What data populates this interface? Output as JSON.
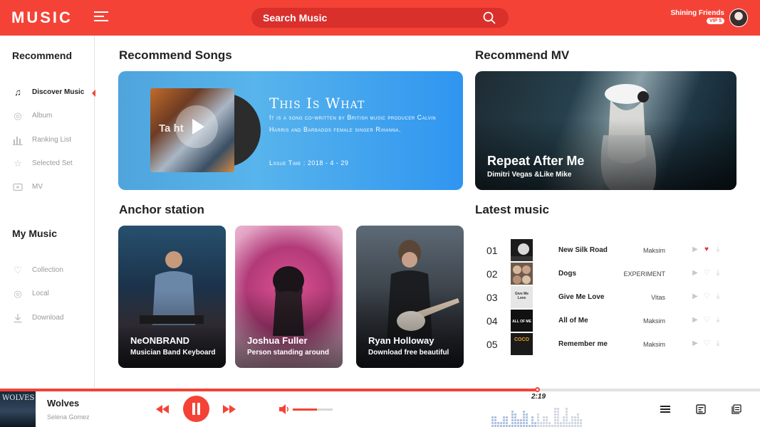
{
  "header": {
    "logo": "MUSIC",
    "search_placeholder": "Search Music",
    "user_name": "Shining Friends",
    "vip_badge": "VIP 5"
  },
  "sidebar": {
    "section1_title": "Recommend",
    "items1": [
      {
        "label": "Discover Music",
        "icon": "music-note-icon",
        "active": true
      },
      {
        "label": "Album",
        "icon": "album-icon"
      },
      {
        "label": "Ranking List",
        "icon": "bar-chart-icon"
      },
      {
        "label": "Selected Set",
        "icon": "star-icon"
      },
      {
        "label": "MV",
        "icon": "video-icon"
      }
    ],
    "section2_title": "My Music",
    "items2": [
      {
        "label": "Collection",
        "icon": "heart-icon"
      },
      {
        "label": "Local",
        "icon": "disc-icon"
      },
      {
        "label": "Download",
        "icon": "download-icon"
      }
    ]
  },
  "recommend_songs": {
    "title": "Recommend Songs",
    "cover_text": "Ta       ht",
    "song_title": "This Is What",
    "description": "It is a song co-written by British music producer Calvin Harris and Barbados female singer Rihanna.",
    "issue": "Lssue Time : 2018 - 4 - 29"
  },
  "recommend_mv": {
    "title": "Recommend MV",
    "mv_title": "Repeat After Me",
    "mv_artist": "Dimitri Vegas &Like Mike"
  },
  "anchor_station": {
    "title": "Anchor station",
    "cards": [
      {
        "name": "NeONBRAND",
        "desc": "Musician Band Keyboard"
      },
      {
        "name": "Joshua Fuller",
        "desc": "Person standing around"
      },
      {
        "name": "Ryan Holloway",
        "desc": "Download free beautiful"
      }
    ]
  },
  "latest_music": {
    "title": "Latest music",
    "rows": [
      {
        "num": "01",
        "title": "New Silk Road",
        "artist": "Maksim",
        "liked": true,
        "thumb_text": ""
      },
      {
        "num": "02",
        "title": "Dogs",
        "artist": "EXPERIMENT",
        "liked": false,
        "thumb_text": ""
      },
      {
        "num": "03",
        "title": "Give Me Love",
        "artist": "Vitas",
        "liked": false,
        "thumb_text": "Give Me Love"
      },
      {
        "num": "04",
        "title": "All of Me",
        "artist": "Maksim",
        "liked": false,
        "thumb_text": "ALL OF ME"
      },
      {
        "num": "05",
        "title": "Remember me",
        "artist": "Maksim",
        "liked": false,
        "thumb_text": "COCO"
      }
    ]
  },
  "player": {
    "album_text": "WOLVES",
    "title": "Wolves",
    "artist": "Selena Gomez",
    "time": "2:19",
    "progress": 0.708,
    "volume": 0.6
  },
  "colors": {
    "accent": "#f44336",
    "heart_active": "#e53935",
    "banner": "#4fa4dc"
  }
}
